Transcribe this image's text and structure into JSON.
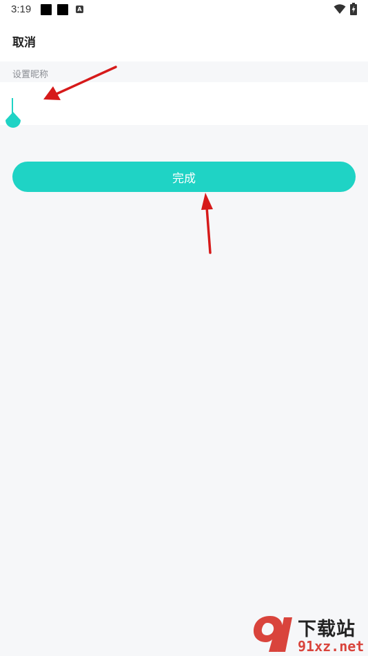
{
  "status_bar": {
    "time": "3:19",
    "notification_icons": [
      "app-notification-icon",
      "app-notification-icon",
      "a-letter-icon"
    ],
    "notification_letter": "A",
    "right_icons": [
      "wifi-icon",
      "battery-charging-icon"
    ]
  },
  "header": {
    "cancel_label": "取消"
  },
  "form": {
    "nickname_label": "设置昵称",
    "nickname_value": "",
    "nickname_placeholder": ""
  },
  "actions": {
    "done_label": "完成"
  },
  "annotations": [
    "red-arrow-icon",
    "red-arrow-icon"
  ],
  "watermark": {
    "cn_text": "下载站",
    "en_text": "91xz.net"
  },
  "colors": {
    "accent": "#1fd3c5",
    "background": "#f6f7f9",
    "annotation_arrow": "#d61a1a",
    "watermark_red": "#d9443c"
  }
}
